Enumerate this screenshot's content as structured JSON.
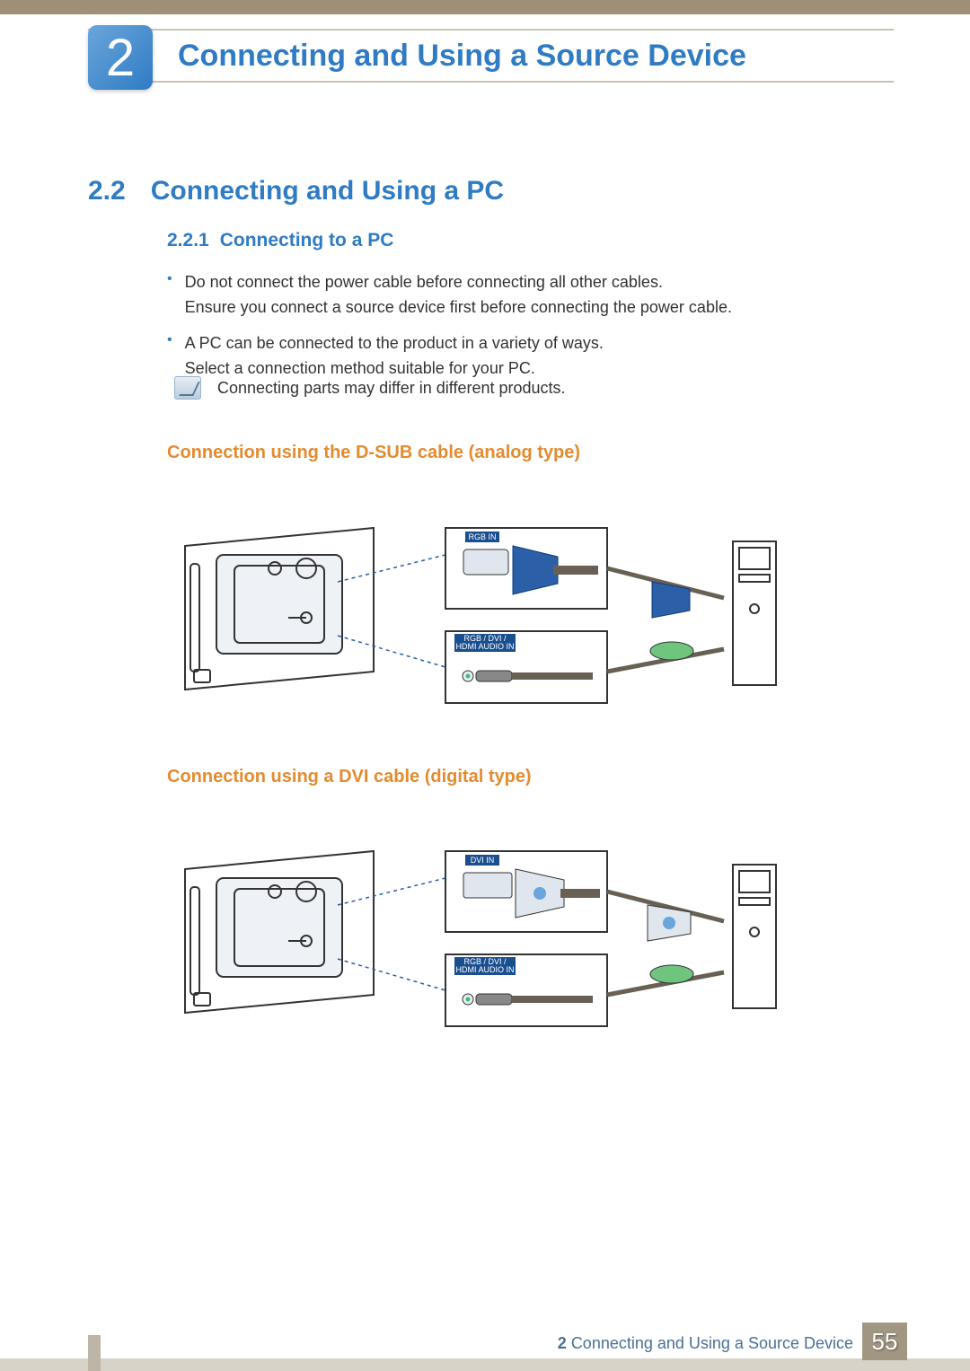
{
  "chapter": {
    "number": "2",
    "title": "Connecting and Using a Source Device"
  },
  "section": {
    "number": "2.2",
    "title": "Connecting and Using a PC"
  },
  "subsection": {
    "number": "2.2.1",
    "title": "Connecting to a PC"
  },
  "bullets": [
    {
      "line1": "Do not connect the power cable before connecting all other cables.",
      "line2": "Ensure you connect a source device first before connecting the power cable."
    },
    {
      "line1": "A PC can be connected to the product in a variety of ways.",
      "line2": "Select a connection method suitable for your PC."
    }
  ],
  "note": "Connecting parts may differ in different products.",
  "headings": {
    "dsub": "Connection using the D-SUB cable (analog type)",
    "dvi": "Connection using a DVI cable (digital type)"
  },
  "diagram_labels": {
    "dsub_port": "RGB IN",
    "dvi_port": "DVI IN",
    "audio_port1": "RGB / DVI /",
    "audio_port2": "HDMI AUDIO IN"
  },
  "footer": {
    "chapter_ref": "2",
    "chapter_title": "Connecting and Using a Source Device",
    "page": "55"
  },
  "colors": {
    "primary_blue": "#2f7bc4",
    "accent_orange": "#e38b2f",
    "beige": "#a08f77"
  }
}
